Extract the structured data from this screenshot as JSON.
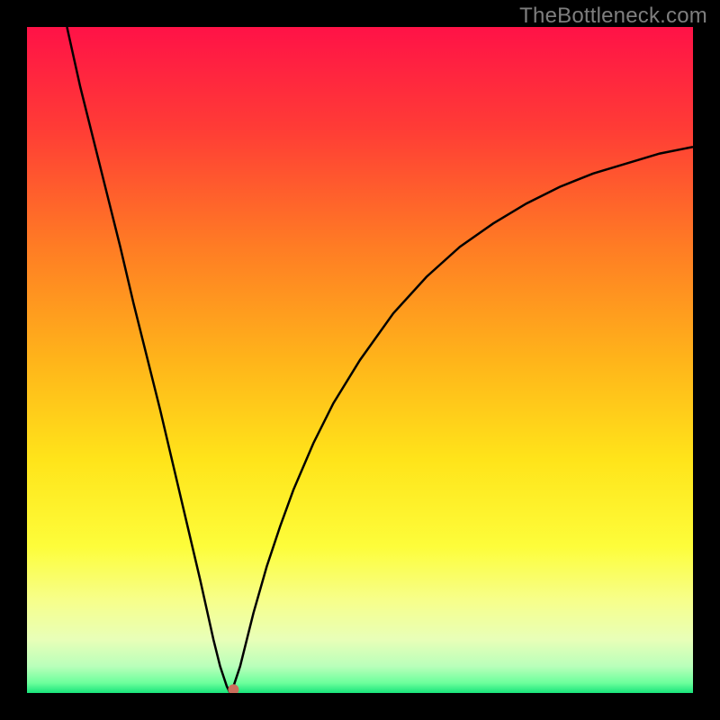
{
  "watermark": "TheBottleneck.com",
  "chart_data": {
    "type": "line",
    "title": "",
    "xlabel": "",
    "ylabel": "",
    "xlim": [
      0,
      100
    ],
    "ylim": [
      0,
      100
    ],
    "x": [
      6,
      8,
      10,
      12,
      14,
      16,
      18,
      20,
      22,
      24,
      26,
      27,
      28,
      29,
      30,
      30.5,
      31,
      32,
      33,
      34,
      36,
      38,
      40,
      43,
      46,
      50,
      55,
      60,
      65,
      70,
      75,
      80,
      85,
      90,
      95,
      100
    ],
    "values": [
      100,
      91,
      83,
      75,
      67,
      58.5,
      50.5,
      42.5,
      34,
      25.5,
      17,
      12.5,
      8,
      4,
      1,
      0,
      1,
      4,
      8,
      12,
      19,
      25,
      30.5,
      37.5,
      43.5,
      50,
      57,
      62.5,
      67,
      70.5,
      73.5,
      76,
      78,
      79.5,
      81,
      82
    ],
    "minimum_point": {
      "x": 30.5,
      "y": 0
    },
    "marker": {
      "x": 31.0,
      "y": 0.5
    },
    "gradient_stops": [
      {
        "pos": 0,
        "color": "#ff1247"
      },
      {
        "pos": 15,
        "color": "#ff3b36"
      },
      {
        "pos": 33,
        "color": "#ff7c24"
      },
      {
        "pos": 50,
        "color": "#ffb41a"
      },
      {
        "pos": 65,
        "color": "#ffe41a"
      },
      {
        "pos": 78,
        "color": "#fdfd3a"
      },
      {
        "pos": 86,
        "color": "#f7ff8a"
      },
      {
        "pos": 92,
        "color": "#e8ffb8"
      },
      {
        "pos": 96,
        "color": "#b9ffba"
      },
      {
        "pos": 98.5,
        "color": "#6cff9c"
      },
      {
        "pos": 100,
        "color": "#18e47a"
      }
    ],
    "colors": {
      "curve": "#000000",
      "marker": "#cb6e5c",
      "background_border": "#000000"
    }
  }
}
